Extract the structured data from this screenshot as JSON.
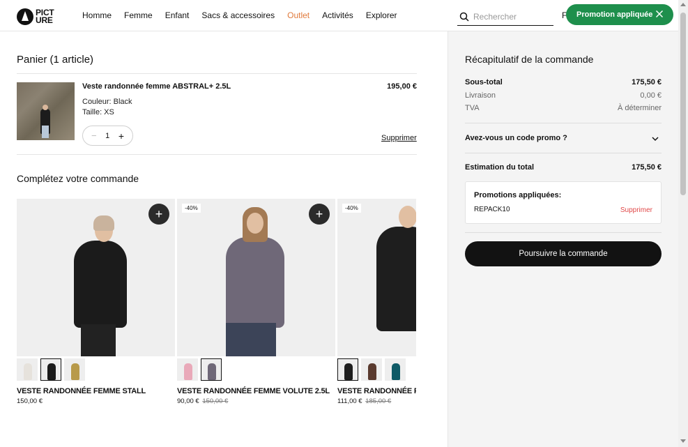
{
  "header": {
    "logo_text": "PICT URE",
    "nav": [
      {
        "label": "Homme"
      },
      {
        "label": "Femme"
      },
      {
        "label": "Enfant"
      },
      {
        "label": "Sacs & accessoires"
      },
      {
        "label": "Outlet"
      },
      {
        "label": "Activités"
      },
      {
        "label": "Explorer"
      }
    ],
    "search_placeholder": "Rechercher",
    "extra_text": "F",
    "toast_text": "Promotion appliquée",
    "outlet_color": "#e07a3c",
    "toast_color": "#1e8f4c"
  },
  "cart": {
    "title": "Panier (1 article)",
    "item": {
      "name": "Veste randonnée femme ABSTRAL+ 2.5L",
      "price": "195,00 €",
      "color": "Couleur: Black",
      "size": "Taille: XS",
      "quantity": "1",
      "minus": "−",
      "plus": "+",
      "remove": "Supprimer"
    }
  },
  "recommendations": {
    "title": "Complétez votre commande",
    "products": [
      {
        "name": "VESTE RANDONNÉE FEMME STALL",
        "price": "150,00 €",
        "old_price": "",
        "badge": "",
        "add": "+"
      },
      {
        "name": "VESTE RANDONNÉE FEMME VOLUTE 2.5L",
        "price": "90,00 €",
        "old_price": "150,00 €",
        "badge": "-40%",
        "add": "+"
      },
      {
        "name": "VESTE RANDONNÉE FEMME FREEL",
        "price": "111,00 €",
        "old_price": "185,00 €",
        "badge": "-40%",
        "add": ""
      }
    ]
  },
  "summary": {
    "title": "Récapitulatif de la commande",
    "subtotal_label": "Sous-total",
    "subtotal_value": "175,50 €",
    "shipping_label": "Livraison",
    "shipping_value": "0,00 €",
    "tax_label": "TVA",
    "tax_value": "À déterminer",
    "promo_question": "Avez-vous un code promo ?",
    "total_label": "Estimation du total",
    "total_value": "175,50 €",
    "promos_title": "Promotions appliquées:",
    "promo_code": "REPACK10",
    "promo_remove": "Supprimer",
    "checkout_label": "Poursuivre la commande",
    "remove_color": "#e04848"
  }
}
